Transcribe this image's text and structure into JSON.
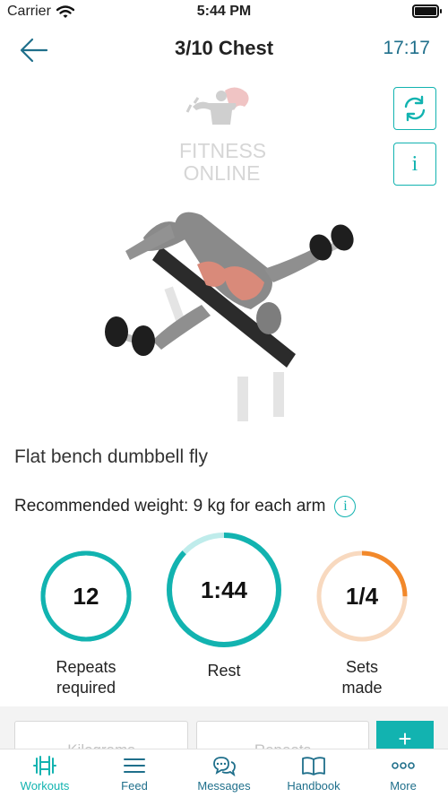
{
  "status_bar": {
    "carrier": "Carrier",
    "time": "5:44 PM"
  },
  "header": {
    "title": "3/10 Chest",
    "timer": "17:17"
  },
  "side_buttons": {
    "info_label": "i"
  },
  "logo": {
    "line1": "FITNESS",
    "line2": "ONLINE"
  },
  "exercise": {
    "name": "Flat bench dumbbell fly",
    "recommended": "Recommended weight: 9 kg for each arm",
    "info_label": "i"
  },
  "stats": [
    {
      "value": "12",
      "label_line1": "Repeats",
      "label_line2": "required",
      "progress": 1.0,
      "color": "#12b3b0",
      "track": "#12b3b0"
    },
    {
      "value": "1:44",
      "label_line1": "Rest",
      "label_line2": "",
      "progress": 0.87,
      "color": "#12b3b0",
      "track": "#bfeceb"
    },
    {
      "value": "1/4",
      "label_line1": "Sets",
      "label_line2": "made",
      "progress": 0.25,
      "color": "#f2882a",
      "track": "#f8d9bf"
    }
  ],
  "inputs": {
    "kg_placeholder": "Kilograms",
    "reps_placeholder": "Repeats",
    "add_label": "+"
  },
  "tabbar": [
    {
      "label": "Workouts",
      "icon": "dumbbell-icon",
      "active": true
    },
    {
      "label": "Feed",
      "icon": "feed-icon",
      "active": false
    },
    {
      "label": "Messages",
      "icon": "messages-icon",
      "active": false
    },
    {
      "label": "Handbook",
      "icon": "book-icon",
      "active": false
    },
    {
      "label": "More",
      "icon": "more-icon",
      "active": false
    }
  ],
  "colors": {
    "accent": "#12b3b0",
    "header_timer": "#1f6f8b",
    "sets": "#f2882a"
  }
}
